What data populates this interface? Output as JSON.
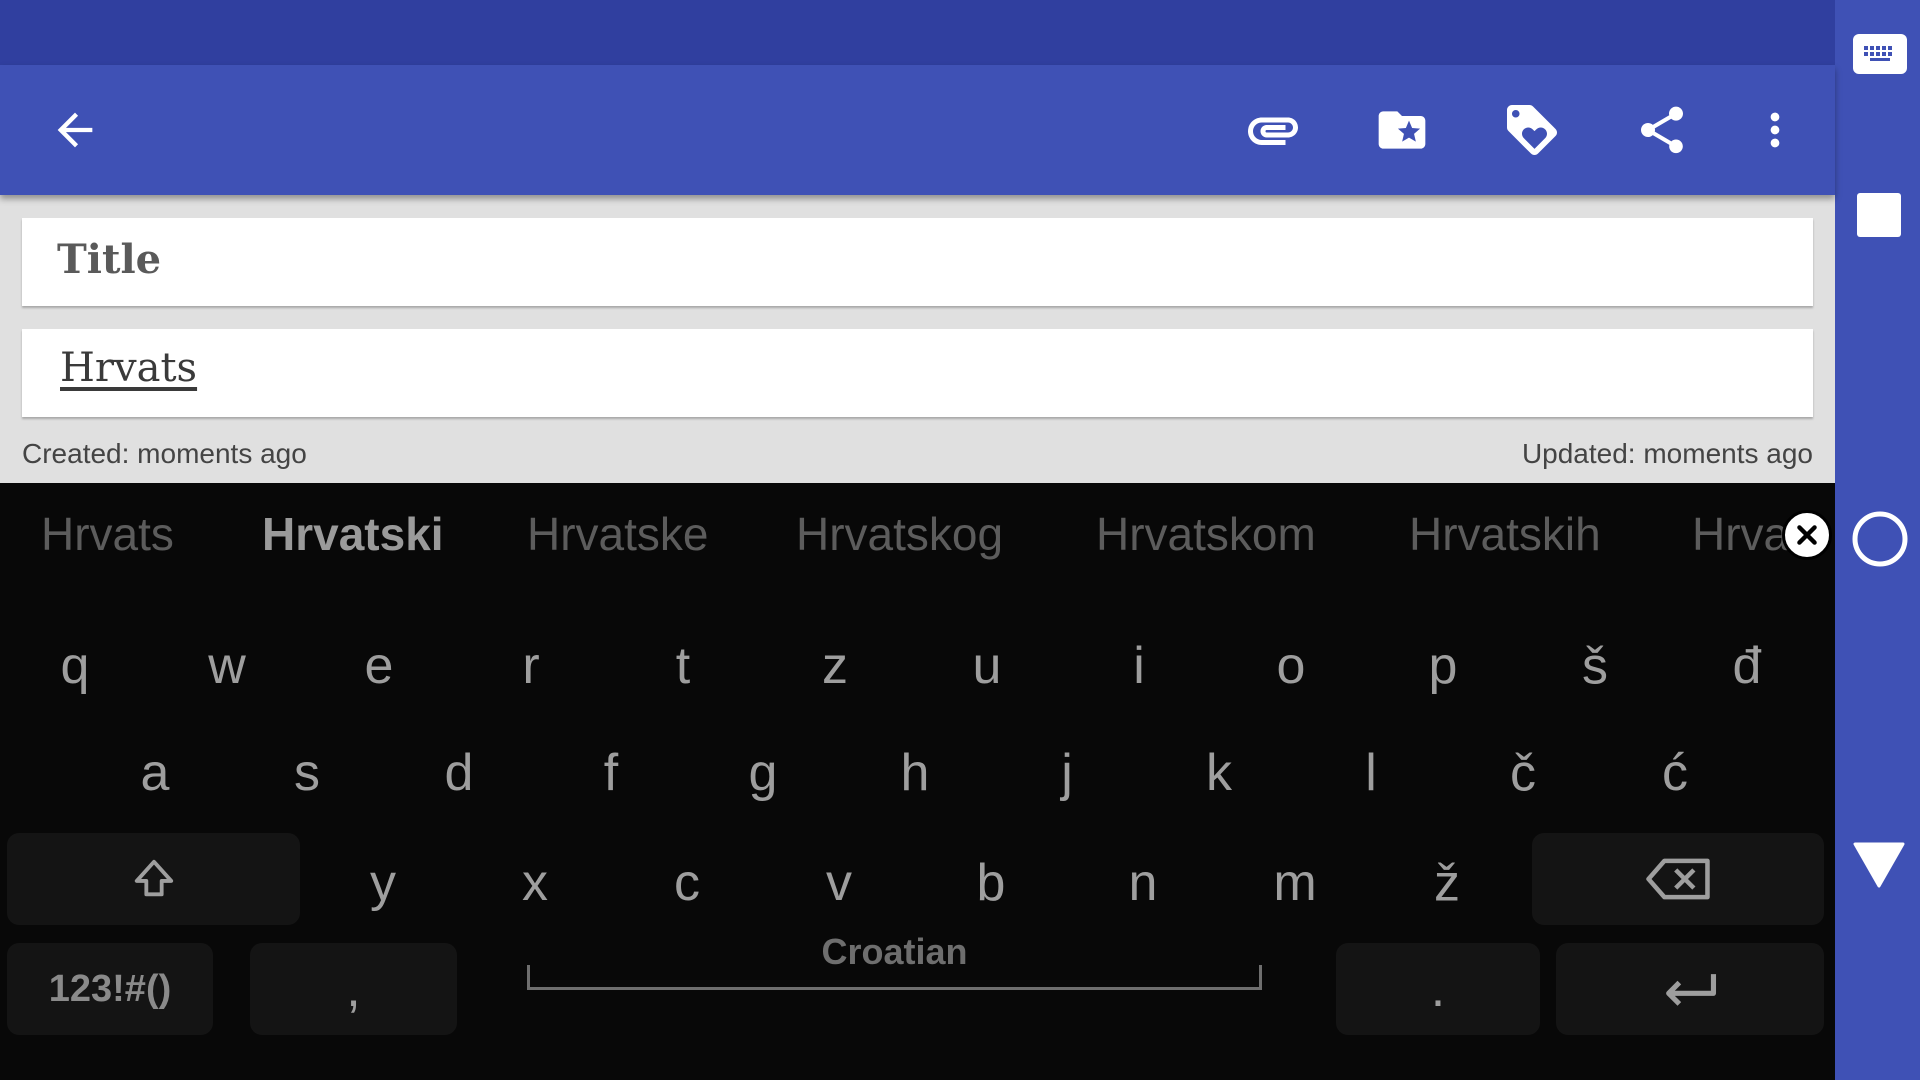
{
  "app": {
    "toolbar": {
      "back": "back-arrow-icon",
      "actions": [
        "paperclip-icon",
        "folder-star-icon",
        "tag-heart-icon",
        "share-icon",
        "more-vert-icon"
      ]
    },
    "title_placeholder": "Title",
    "body_text": "Hrvats",
    "created": "Created: moments ago",
    "updated": "Updated: moments ago"
  },
  "keyboard": {
    "suggestions": [
      "Hrvats",
      "Hrvatski",
      "Hrvatske",
      "Hrvatskog",
      "Hrvatskom",
      "Hrvatskih",
      "Hrva"
    ],
    "row1": [
      "q",
      "w",
      "e",
      "r",
      "t",
      "z",
      "u",
      "i",
      "o",
      "p",
      "š",
      "đ"
    ],
    "row2": [
      "a",
      "s",
      "d",
      "f",
      "g",
      "h",
      "j",
      "k",
      "l",
      "č",
      "ć"
    ],
    "row3": [
      "y",
      "x",
      "c",
      "v",
      "b",
      "n",
      "m",
      "ž"
    ],
    "symbols_label": "123!#()",
    "comma": ",",
    "space_label": "Croatian",
    "period": "."
  },
  "colors": {
    "primary": "#3f51b5",
    "primary_dark": "#303f9f",
    "keyboard_bg": "#080808"
  }
}
